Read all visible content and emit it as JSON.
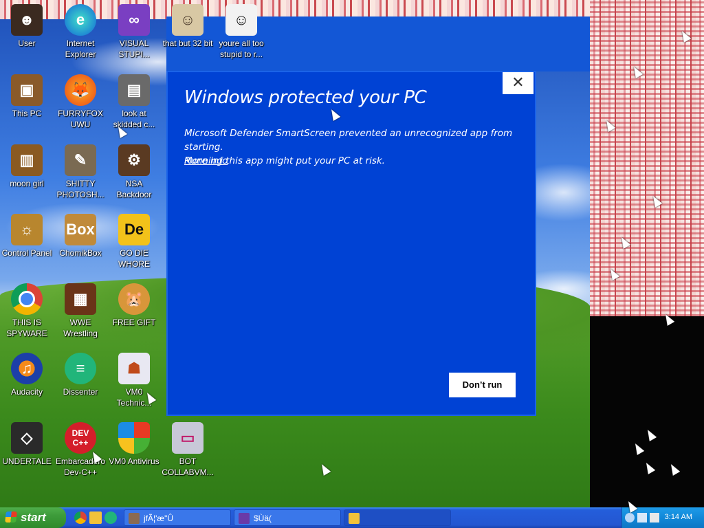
{
  "desktop": {
    "icons": [
      {
        "label": "User",
        "icon": "user-icon"
      },
      {
        "label": "Internet Explorer",
        "icon": "edge-browser-icon"
      },
      {
        "label": "VISUAL STUPI...",
        "icon": "visual-studio-icon"
      },
      {
        "label": "that but 32 bit",
        "icon": "portrait-icon"
      },
      {
        "label": "youre all too stupid to r...",
        "icon": "portrait-bw-icon"
      },
      {
        "label": "This PC",
        "icon": "computer-icon"
      },
      {
        "label": "FURRYFOX UWU",
        "icon": "firefox-icon"
      },
      {
        "label": "look at skidded c...",
        "icon": "stack-icon"
      },
      {
        "label": "moon girl",
        "icon": "cabinet-icon"
      },
      {
        "label": "SHITTY PHOTOSH...",
        "icon": "gimp-icon"
      },
      {
        "label": "NSA Backdoor",
        "icon": "machine-icon"
      },
      {
        "label": "Control Panel",
        "icon": "control-panel-icon"
      },
      {
        "label": "ChomikBox",
        "icon": "hamster-box-icon"
      },
      {
        "label": "GO DIE WHORE",
        "icon": "de-icon"
      },
      {
        "label": "THIS IS SPYWARE",
        "icon": "chrome-icon"
      },
      {
        "label": "WWE Wrestling",
        "icon": "wrestling-icon"
      },
      {
        "label": "FREE GIFT",
        "icon": "gift-icon"
      },
      {
        "label": "Audacity",
        "icon": "audacity-icon"
      },
      {
        "label": "Dissenter",
        "icon": "dissenter-icon"
      },
      {
        "label": "VM0 Technic...",
        "icon": "technician-icon"
      },
      {
        "label": "UNDERTALE",
        "icon": "unity-icon"
      },
      {
        "label": "Embarcadero Dev-C++",
        "icon": "devcpp-icon"
      },
      {
        "label": "VM0 Antivirus",
        "icon": "shield-icon"
      },
      {
        "label": "BOT COLLABVM...",
        "icon": "monitor-icon"
      }
    ]
  },
  "dialog": {
    "title": "Windows protected your PC",
    "message_line1": "Microsoft Defender SmartScreen prevented an unrecognized app from starting.",
    "message_line2": "Running this app might put your PC at risk.",
    "more_info": "More info",
    "dont_run": "Don’t run",
    "close": "✕"
  },
  "taskbar": {
    "start_label": "start",
    "tasks": [
      {
        "label": "jfÃ¦'æ\"Û"
      },
      {
        "label": "$Ùä("
      },
      {
        "label": ""
      }
    ],
    "clock": "3:14 AM"
  },
  "colors": {
    "dialog_bg": "#0042d4",
    "taskbar_blue": "#245edb",
    "start_green": "#3d9b3a"
  }
}
